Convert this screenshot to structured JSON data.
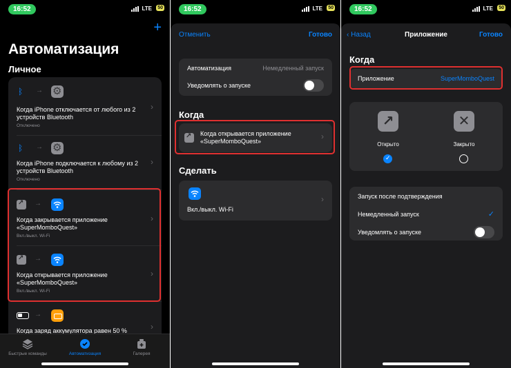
{
  "status": {
    "time": "16:52",
    "network": "LTE",
    "battery": "50"
  },
  "screen1": {
    "title": "Автоматизация",
    "section": "Личное",
    "items": [
      {
        "title": "Когда iPhone отключается от любого из 2 устройств Bluetooth",
        "subtitle": "Отключено"
      },
      {
        "title": "Когда iPhone подключается к любому из 2 устройств Bluetooth",
        "subtitle": "Отключено"
      },
      {
        "title": "Когда закрывается приложение «SuperMomboQuest»",
        "subtitle": "Вкл./выкл. Wi-Fi"
      },
      {
        "title": "Когда открывается приложение «SuperMomboQuest»",
        "subtitle": "Вкл./выкл. Wi-Fi"
      },
      {
        "title": "Когда заряд аккумулятора равен 50 %",
        "subtitle": ""
      }
    ],
    "tabs": [
      {
        "label": "Быстрые команды"
      },
      {
        "label": "Автоматизация"
      },
      {
        "label": "Галерея"
      }
    ]
  },
  "screen2": {
    "cancel": "Отменить",
    "done": "Готово",
    "automation_label": "Автоматизация",
    "automation_value": "Немедленный запуск",
    "notify_label": "Уведомлять о запуске",
    "when_header": "Когда",
    "when_item": "Когда открывается приложение «SuperMomboQuest»",
    "do_header": "Сделать",
    "do_item": "Вкл./выкл. Wi-Fi"
  },
  "screen3": {
    "back": "Назад",
    "title": "Приложение",
    "done": "Готово",
    "when_header": "Когда",
    "app_label": "Приложение",
    "app_value": "SuperMomboQuest",
    "opened": "Открыто",
    "closed": "Закрыто",
    "options": [
      {
        "label": "Запуск после подтверждения"
      },
      {
        "label": "Немедленный запуск"
      },
      {
        "label": "Уведомлять о запуске"
      }
    ]
  },
  "colors": {
    "accent": "#0a84ff",
    "highlight": "#e03030",
    "time_pill": "#30c85e"
  }
}
